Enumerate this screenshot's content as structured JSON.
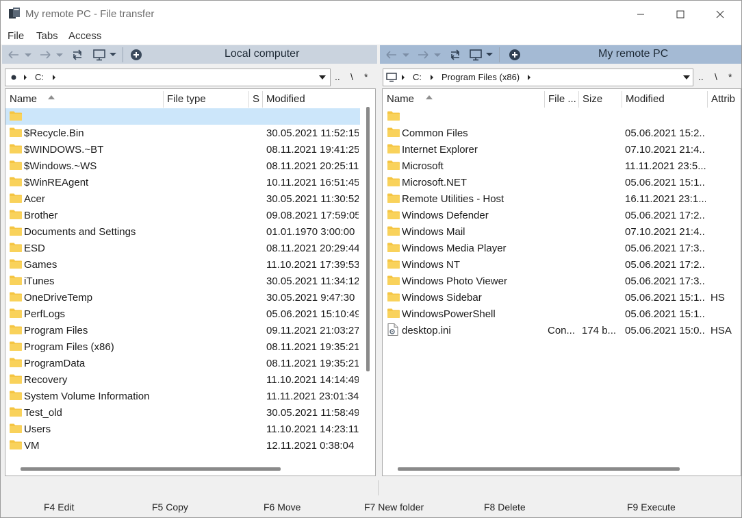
{
  "window": {
    "title": "My remote PC - File transfer"
  },
  "menu": [
    "File",
    "Tabs",
    "Access"
  ],
  "left_panel": {
    "title": "Local computer",
    "path": {
      "drive": "C:"
    },
    "tools": [
      "..",
      "\\",
      "*"
    ],
    "columns": [
      "Name",
      "File type",
      "S",
      "Modified"
    ],
    "rows": [
      {
        "name": "",
        "type": "",
        "modified": "",
        "selected": true
      },
      {
        "name": "$Recycle.Bin",
        "type": "",
        "modified": "30.05.2021 11:52:15"
      },
      {
        "name": "$WINDOWS.~BT",
        "type": "",
        "modified": "08.11.2021 19:41:25"
      },
      {
        "name": "$Windows.~WS",
        "type": "",
        "modified": "08.11.2021 20:25:11"
      },
      {
        "name": "$WinREAgent",
        "type": "",
        "modified": "10.11.2021 16:51:45"
      },
      {
        "name": "Acer",
        "type": "",
        "modified": "30.05.2021 11:30:52"
      },
      {
        "name": "Brother",
        "type": "",
        "modified": "09.08.2021 17:59:05"
      },
      {
        "name": "Documents and Settings",
        "type": "",
        "modified": "01.01.1970 3:00:00"
      },
      {
        "name": "ESD",
        "type": "",
        "modified": "08.11.2021 20:29:44"
      },
      {
        "name": "Games",
        "type": "",
        "modified": "11.10.2021 17:39:53"
      },
      {
        "name": "iTunes",
        "type": "",
        "modified": "30.05.2021 11:34:12"
      },
      {
        "name": "OneDriveTemp",
        "type": "",
        "modified": "30.05.2021 9:47:30"
      },
      {
        "name": "PerfLogs",
        "type": "",
        "modified": "05.06.2021 15:10:49"
      },
      {
        "name": "Program Files",
        "type": "",
        "modified": "09.11.2021 21:03:27"
      },
      {
        "name": "Program Files (x86)",
        "type": "",
        "modified": "08.11.2021 19:35:21"
      },
      {
        "name": "ProgramData",
        "type": "",
        "modified": "08.11.2021 19:35:21"
      },
      {
        "name": "Recovery",
        "type": "",
        "modified": "11.10.2021 14:14:49"
      },
      {
        "name": "System Volume Information",
        "type": "",
        "modified": "11.11.2021 23:01:34"
      },
      {
        "name": "Test_old",
        "type": "",
        "modified": "30.05.2021 11:58:49"
      },
      {
        "name": "Users",
        "type": "",
        "modified": "11.10.2021 14:23:11"
      },
      {
        "name": "VM",
        "type": "",
        "modified": "12.11.2021 0:38:04"
      }
    ]
  },
  "right_panel": {
    "title": "My remote PC",
    "path": {
      "drive": "C:",
      "folder": "Program Files (x86)"
    },
    "tools": [
      "..",
      "\\",
      "*"
    ],
    "columns": [
      "Name",
      "File ...",
      "Size",
      "Modified",
      "Attrib"
    ],
    "rows": [
      {
        "name": "",
        "type": "",
        "size": "",
        "modified": "",
        "attrib": "",
        "kind": "folder"
      },
      {
        "name": "Common Files",
        "type": "",
        "size": "",
        "modified": "05.06.2021 15:2...",
        "attrib": "",
        "kind": "folder"
      },
      {
        "name": "Internet Explorer",
        "type": "",
        "size": "",
        "modified": "07.10.2021 21:4...",
        "attrib": "",
        "kind": "folder"
      },
      {
        "name": "Microsoft",
        "type": "",
        "size": "",
        "modified": "11.11.2021 23:5...",
        "attrib": "",
        "kind": "folder"
      },
      {
        "name": "Microsoft.NET",
        "type": "",
        "size": "",
        "modified": "05.06.2021 15:1...",
        "attrib": "",
        "kind": "folder"
      },
      {
        "name": "Remote Utilities - Host",
        "type": "",
        "size": "",
        "modified": "16.11.2021 23:1...",
        "attrib": "",
        "kind": "folder"
      },
      {
        "name": "Windows Defender",
        "type": "",
        "size": "",
        "modified": "05.06.2021 17:2...",
        "attrib": "",
        "kind": "folder"
      },
      {
        "name": "Windows Mail",
        "type": "",
        "size": "",
        "modified": "07.10.2021 21:4...",
        "attrib": "",
        "kind": "folder"
      },
      {
        "name": "Windows Media Player",
        "type": "",
        "size": "",
        "modified": "05.06.2021 17:3...",
        "attrib": "",
        "kind": "folder"
      },
      {
        "name": "Windows NT",
        "type": "",
        "size": "",
        "modified": "05.06.2021 17:2...",
        "attrib": "",
        "kind": "folder"
      },
      {
        "name": "Windows Photo Viewer",
        "type": "",
        "size": "",
        "modified": "05.06.2021 17:3...",
        "attrib": "",
        "kind": "folder"
      },
      {
        "name": "Windows Sidebar",
        "type": "",
        "size": "",
        "modified": "05.06.2021 15:1...",
        "attrib": "HS",
        "kind": "folder"
      },
      {
        "name": "WindowsPowerShell",
        "type": "",
        "size": "",
        "modified": "05.06.2021 15:1...",
        "attrib": "",
        "kind": "folder"
      },
      {
        "name": "desktop.ini",
        "type": "Con...",
        "size": "174 b...",
        "modified": "05.06.2021 15:0...",
        "attrib": "HSA",
        "kind": "file"
      }
    ]
  },
  "function_keys": [
    "F4 Edit",
    "F5 Copy",
    "F6 Move",
    "F7 New folder",
    "F8 Delete",
    "F9 Execute"
  ],
  "colors": {
    "left_header_bg": "#cad3de",
    "right_header_bg": "#a4bad4",
    "selected_row": "#cce6fa",
    "folder": "#f5c542"
  }
}
